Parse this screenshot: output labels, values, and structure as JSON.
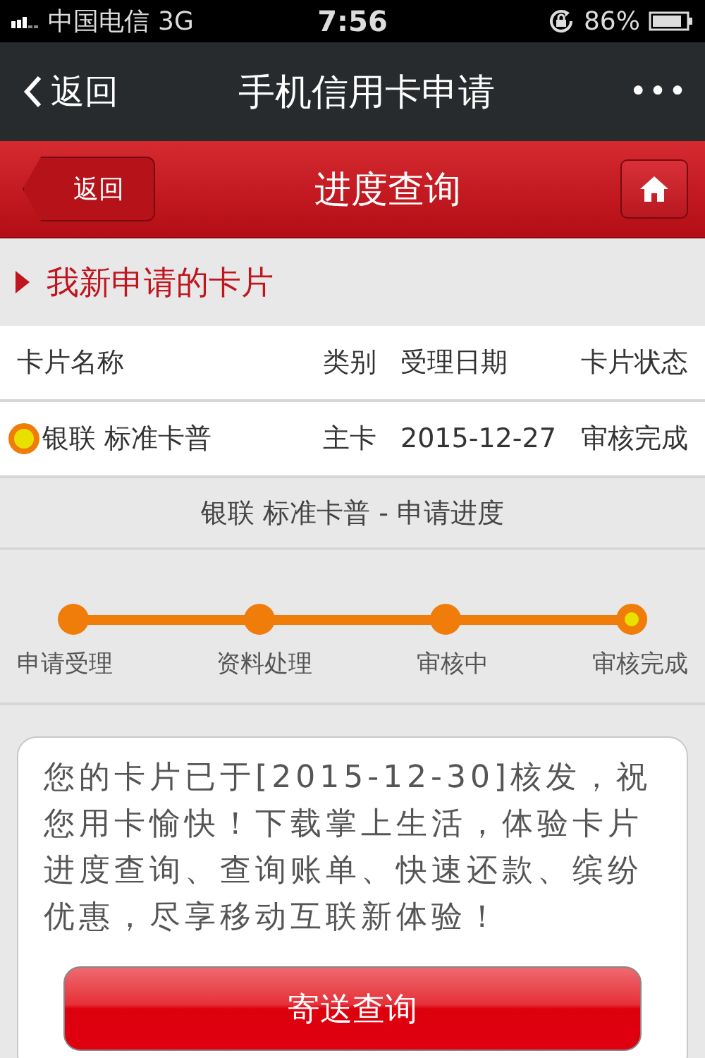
{
  "status_bar": {
    "carrier": "中国电信",
    "network": "3G",
    "time": "7:56",
    "battery": "86%"
  },
  "nav_bar": {
    "back": "返回",
    "title": "手机信用卡申请",
    "more": "•••"
  },
  "header": {
    "back": "返回",
    "title": "进度查询"
  },
  "section": {
    "title": "我新申请的卡片"
  },
  "table": {
    "columns": [
      "卡片名称",
      "类别",
      "受理日期",
      "卡片状态"
    ],
    "rows": [
      {
        "selected": true,
        "cells": [
          "银联 标准卡普",
          "主卡",
          "2015-12-27",
          "审核完成"
        ]
      }
    ]
  },
  "progress": {
    "title": "银联 标准卡普 - 申请进度",
    "steps": [
      {
        "label": "申请受理",
        "selected": false
      },
      {
        "label": "资料处理",
        "selected": false
      },
      {
        "label": "审核中",
        "selected": false
      },
      {
        "label": "审核完成",
        "selected": true
      }
    ]
  },
  "message": {
    "text": "您的卡片已于[2015-12-30]核发，祝您用卡愉快！下载掌上生活，体验卡片进度查询、查询账单、快速还款、缤纷优惠，尽享移动互联新体验！",
    "button": "寄送查询"
  }
}
